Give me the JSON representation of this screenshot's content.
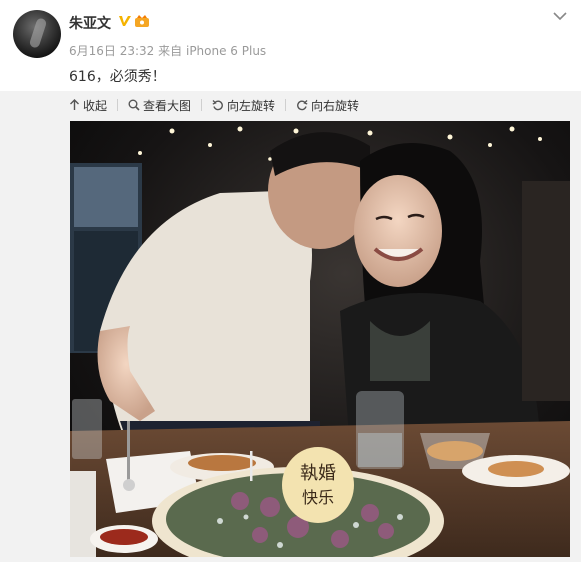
{
  "post": {
    "author": "朱亚文",
    "date": "6月16日 23:32",
    "source_prefix": "来自",
    "source": "iPhone 6 Plus",
    "text": "616，必须秀！"
  },
  "toolbar": {
    "collapse": "收起",
    "view_large": "查看大图",
    "rotate_left": "向左旋转",
    "rotate_right": "向右旋转"
  },
  "photo": {
    "cake_text_line1": "執婚",
    "cake_text_line2": "快乐"
  },
  "colors": {
    "verified": "#f5b300",
    "meta": "#9a9a9a",
    "panel": "#f2f2f2"
  }
}
